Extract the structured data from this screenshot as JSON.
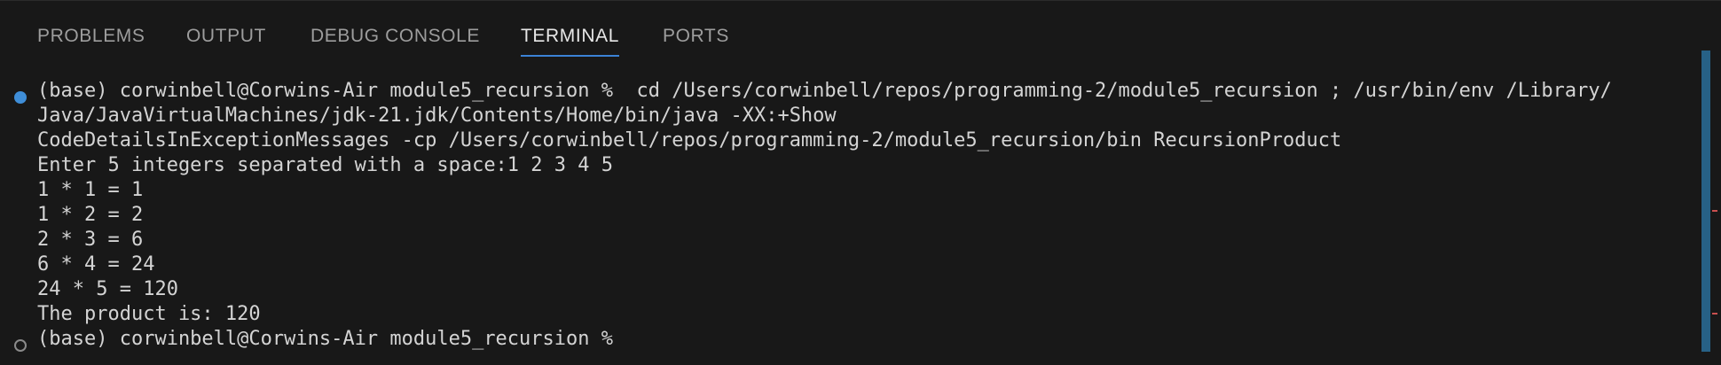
{
  "tabs": [
    {
      "label": "PROBLEMS"
    },
    {
      "label": "OUTPUT"
    },
    {
      "label": "DEBUG CONSOLE"
    },
    {
      "label": "TERMINAL"
    },
    {
      "label": "PORTS"
    }
  ],
  "active_tab": "TERMINAL",
  "terminal": {
    "lines": [
      "(base) corwinbell@Corwins-Air module5_recursion %  cd /Users/corwinbell/repos/programming-2/module5_recursion ; /usr/bin/env /Library/",
      "Java/JavaVirtualMachines/jdk-21.jdk/Contents/Home/bin/java -XX:+Show",
      "CodeDetailsInExceptionMessages -cp /Users/corwinbell/repos/programming-2/module5_recursion/bin RecursionProduct",
      "Enter 5 integers separated with a space:1 2 3 4 5",
      "1 * 1 = 1",
      "1 * 2 = 2",
      "2 * 3 = 6",
      "6 * 4 = 24",
      "24 * 5 = 120",
      "The product is: 120",
      "(base) corwinbell@Corwins-Air module5_recursion %"
    ]
  },
  "colors": {
    "background": "#181818",
    "text": "#d4d4d4",
    "tab_inactive": "#9d9d9d",
    "tab_active": "#e7e7e7",
    "accent": "#3b82d6"
  },
  "icons": {
    "command_success": "filled-circle-icon",
    "command_pending": "hollow-circle-icon"
  }
}
